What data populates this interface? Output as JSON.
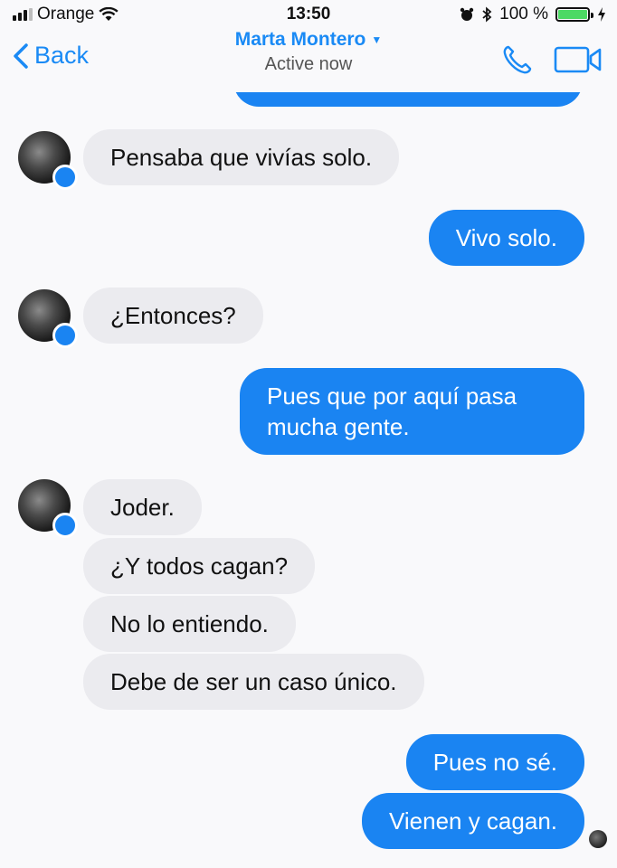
{
  "status_bar": {
    "carrier": "Orange",
    "time": "13:50",
    "battery": "100 %"
  },
  "nav": {
    "back_label": "Back",
    "contact_name": "Marta Montero",
    "status": "Active now"
  },
  "messages": [
    {
      "from": "them",
      "text": "Pensaba que vivías solo."
    },
    {
      "from": "me",
      "text": "Vivo solo."
    },
    {
      "from": "them",
      "text": "¿Entonces?"
    },
    {
      "from": "me",
      "text": "Pues que por aquí pasa",
      "text2": "mucha gente."
    },
    {
      "from": "them",
      "text": "Joder."
    },
    {
      "from": "them",
      "text": "¿Y todos cagan?"
    },
    {
      "from": "them",
      "text": "No lo entiendo."
    },
    {
      "from": "them",
      "text": "Debe de ser un caso único."
    },
    {
      "from": "me",
      "text": "Pues no sé."
    },
    {
      "from": "me",
      "text": "Vienen y cagan."
    }
  ],
  "colors": {
    "accent": "#1a84f2",
    "incoming_bubble": "#ebebef",
    "battery": "#4cd964"
  }
}
